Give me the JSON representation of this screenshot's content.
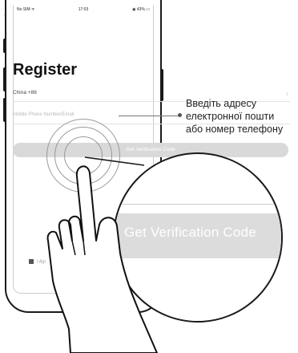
{
  "status_bar": {
    "carrier": "No SIM ᯤ",
    "time": "17:03",
    "battery": "◉ 43% ▭"
  },
  "nav": {
    "back_glyph": "‹"
  },
  "page": {
    "title": "Register"
  },
  "form": {
    "country": "China +86",
    "country_chevron": "›",
    "phone_email_placeholder": "Mobile Phone Number/Email",
    "verify_button": "Get Verification Code",
    "agree_text": "I Agr"
  },
  "callout": {
    "text_lines": [
      "Введіть адресу",
      "електронної пошти",
      "або номер телефону"
    ]
  },
  "magnifier": {
    "label": "Get Verification Code"
  },
  "colors": {
    "button_bg": "#d9d9d9",
    "text": "#111111",
    "placeholder": "#b9b9b9"
  }
}
